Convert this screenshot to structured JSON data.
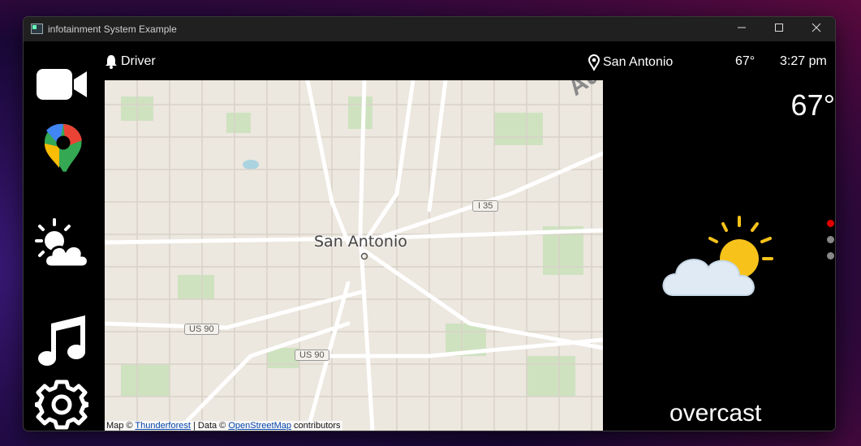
{
  "window": {
    "title": "infotainment System Example",
    "minimize_icon": "minimize-icon",
    "maximize_icon": "maximize-icon",
    "close_icon": "close-icon"
  },
  "sidebar": {
    "items": [
      {
        "name": "video",
        "icon": "video-camera-icon"
      },
      {
        "name": "maps",
        "icon": "map-pin-icon"
      },
      {
        "name": "weather",
        "icon": "partly-cloudy-icon"
      },
      {
        "name": "music",
        "icon": "music-note-icon"
      },
      {
        "name": "settings",
        "icon": "gear-icon"
      }
    ]
  },
  "topbar": {
    "profile_label": "Driver",
    "location_label": "San Antonio",
    "temperature": "67°",
    "time": "3:27 pm"
  },
  "map": {
    "city_label": "San Antonio",
    "highway_labels": [
      "I 35",
      "US 90",
      "US 90"
    ],
    "credit_prefix": "Map © ",
    "credit_link1": "Thunderforest",
    "credit_middle": " | Data © ",
    "credit_link2": "OpenStreetMap",
    "credit_suffix": " contributors"
  },
  "weather": {
    "temperature": "67°",
    "condition": "overcast",
    "icon": "partly-cloudy-icon",
    "page_dots_active_color": "#e00000",
    "page_dots_color": "#888888"
  }
}
